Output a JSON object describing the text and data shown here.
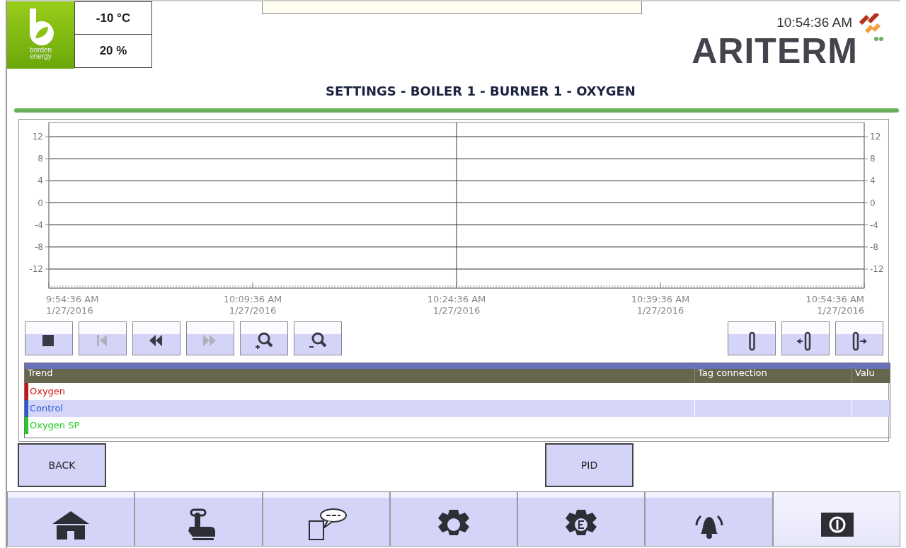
{
  "header": {
    "logo_text": [
      "borden",
      "energy"
    ],
    "temperature": "-10 °C",
    "humidity": "20 %",
    "time": "10:54:36 AM",
    "brand": "ARITERM"
  },
  "title": "SETTINGS - BOILER 1 - BURNER 1 - OXYGEN",
  "trend_chart": {
    "chart_data": {
      "type": "line",
      "grid": true,
      "ylim": [
        -12,
        12
      ],
      "yticks": [
        12,
        8,
        4,
        0,
        -4,
        -8,
        -12
      ],
      "categories": [
        "9:54:36 AM",
        "10:09:36 AM",
        "10:24:36 AM",
        "10:39:36 AM",
        "10:54:36 AM"
      ]
    },
    "right_axis_labels": [
      "12",
      "8",
      "4",
      "0",
      "-4",
      "-8",
      "-12"
    ],
    "x_dates": [
      "1/27/2016",
      "1/27/2016",
      "1/27/2016",
      "1/27/2016",
      "1/27/2016"
    ]
  },
  "toolbar_left": [
    {
      "kind": "stop",
      "disabled": false
    },
    {
      "kind": "first",
      "disabled": true
    },
    {
      "kind": "rewind",
      "disabled": false
    },
    {
      "kind": "forward",
      "disabled": true
    },
    {
      "kind": "zoom_in",
      "disabled": false
    },
    {
      "kind": "zoom_out",
      "disabled": false
    }
  ],
  "toolbar_right": [
    {
      "kind": "ruler"
    },
    {
      "kind": "ruler_left"
    },
    {
      "kind": "ruler_right"
    }
  ],
  "trend_table": {
    "columns": [
      "Trend",
      "Tag connection",
      "Valu"
    ],
    "rows": [
      {
        "name": "Oxygen",
        "color": "#cc1111"
      },
      {
        "name": "Control",
        "color": "#2a5bd7"
      },
      {
        "name": "Oxygen SP",
        "color": "#22cc22"
      }
    ]
  },
  "buttons": [
    "BACK",
    "PID"
  ],
  "nav": [
    {
      "kind": "home",
      "selected": false
    },
    {
      "kind": "hand",
      "selected": false
    },
    {
      "kind": "sms",
      "selected": false
    },
    {
      "kind": "gear",
      "selected": false
    },
    {
      "kind": "gear_e",
      "selected": false
    },
    {
      "kind": "bell",
      "selected": false
    },
    {
      "kind": "power",
      "selected": true
    }
  ]
}
